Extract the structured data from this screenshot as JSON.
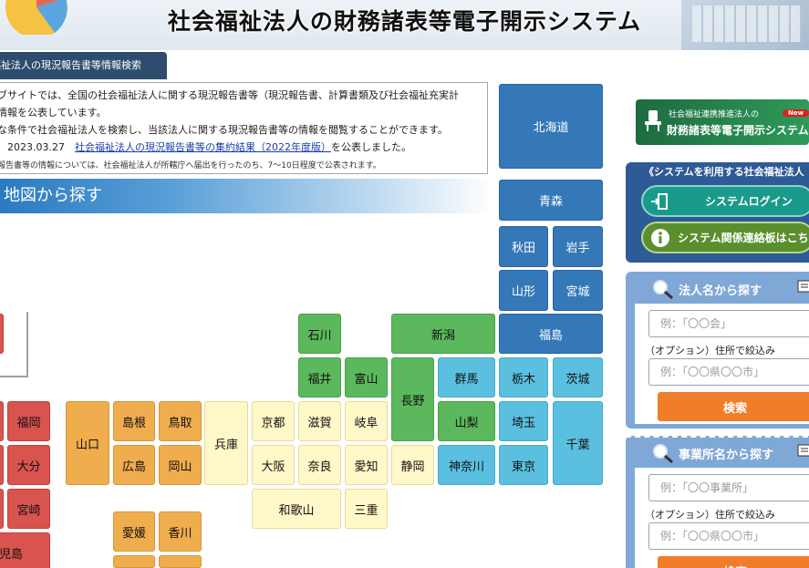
{
  "header": {
    "title": "社会福祉法人の財務諸表等電子開示システム"
  },
  "section_tab": "福祉法人の現況報告書等情報検索",
  "info": {
    "line1": "ブサイトでは、全国の社会福祉法人に関する現況報告書等（現況報告書、計算書類及び社会福祉充実計",
    "line2": "情報を公表しています。",
    "line3": "な条件で社会福祉法人を検索し、当該法人に関する現況報告書等の情報を閲覧することができます。",
    "line4_date": "2023.03.27",
    "line4_link": "社会福祉法人の現況報告書等の集約結果（2022年度版）",
    "line4_suffix": "を公表しました。",
    "note": "報告書等の情報については、社会福祉法人が所轄庁へ届出を行ったのち、7〜10日程度で公表されます。"
  },
  "map_heading": "地図から探す",
  "prefectures": {
    "hokkaido": "北海道",
    "aomori": "青森",
    "akita": "秋田",
    "iwate": "岩手",
    "yamagata": "山形",
    "miyagi": "宮城",
    "fukushima": "福島",
    "ishikawa": "石川",
    "niigata": "新潟",
    "fukui": "福井",
    "toyama": "富山",
    "nagano": "長野",
    "gunma": "群馬",
    "tochigi": "栃木",
    "ibaraki": "茨城",
    "yamanashi": "山梨",
    "saitama": "埼玉",
    "chiba": "千葉",
    "shizuoka": "静岡",
    "kanagawa": "神奈川",
    "tokyo": "東京",
    "kyoto": "京都",
    "shiga": "滋賀",
    "gifu": "岐阜",
    "hyogo": "兵庫",
    "osaka": "大阪",
    "nara": "奈良",
    "aichi": "愛知",
    "wakayama": "和歌山",
    "mie": "三重",
    "yamaguchi": "山口",
    "shimane": "島根",
    "tottori": "鳥取",
    "hiroshima": "広島",
    "okayama": "岡山",
    "ehime": "愛媛",
    "kagawa": "香川",
    "fukuoka": "福岡",
    "oita": "大分",
    "miyazaki": "宮崎",
    "kagoshima": "児島"
  },
  "banner": {
    "small": "社会福祉連携推進法人の",
    "new_badge": "New",
    "big": "財務諸表等電子開示システム"
  },
  "system_panel": {
    "title": "《システムを利用する社会福祉法人",
    "login": "システムログイン",
    "board": "システム関係連絡板はこち"
  },
  "search_corp": {
    "title": "法人名から探す",
    "name_placeholder": "例：「〇〇会」",
    "option_label": "（オプション）住所で絞込み",
    "address_placeholder": "例：「〇〇県〇〇市」",
    "button": "検索"
  },
  "search_office": {
    "title": "事業所名から探す",
    "name_placeholder": "例：「〇〇事業所」",
    "option_label": "（オプション）住所で絞込み",
    "address_placeholder": "例：「〇〇県〇〇市」",
    "button": "検索"
  },
  "colors": {
    "hokkaido_tohoku": "#3478b8",
    "kanto": "#5bbfe0",
    "chubu": "#5cb85c",
    "kinki": "#fff8c8",
    "chugoku_shikoku": "#f0ad4e",
    "kyushu": "#d9534f",
    "search_button": "#f07d2a"
  }
}
